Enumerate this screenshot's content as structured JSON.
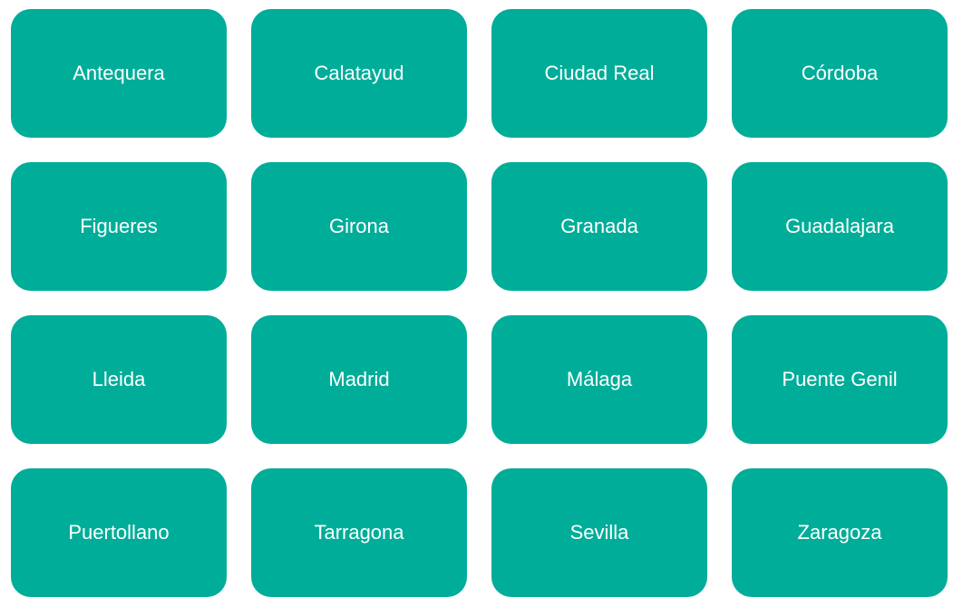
{
  "tiles": [
    {
      "label": "Antequera"
    },
    {
      "label": "Calatayud"
    },
    {
      "label": "Ciudad Real"
    },
    {
      "label": "Córdoba"
    },
    {
      "label": "Figueres"
    },
    {
      "label": "Girona"
    },
    {
      "label": "Granada"
    },
    {
      "label": "Guadalajara"
    },
    {
      "label": "Lleida"
    },
    {
      "label": "Madrid"
    },
    {
      "label": "Málaga"
    },
    {
      "label": "Puente Genil"
    },
    {
      "label": "Puertollano"
    },
    {
      "label": "Tarragona"
    },
    {
      "label": "Sevilla"
    },
    {
      "label": "Zaragoza"
    }
  ],
  "colors": {
    "tile_background": "#00ad99",
    "tile_text": "#ffffff"
  }
}
